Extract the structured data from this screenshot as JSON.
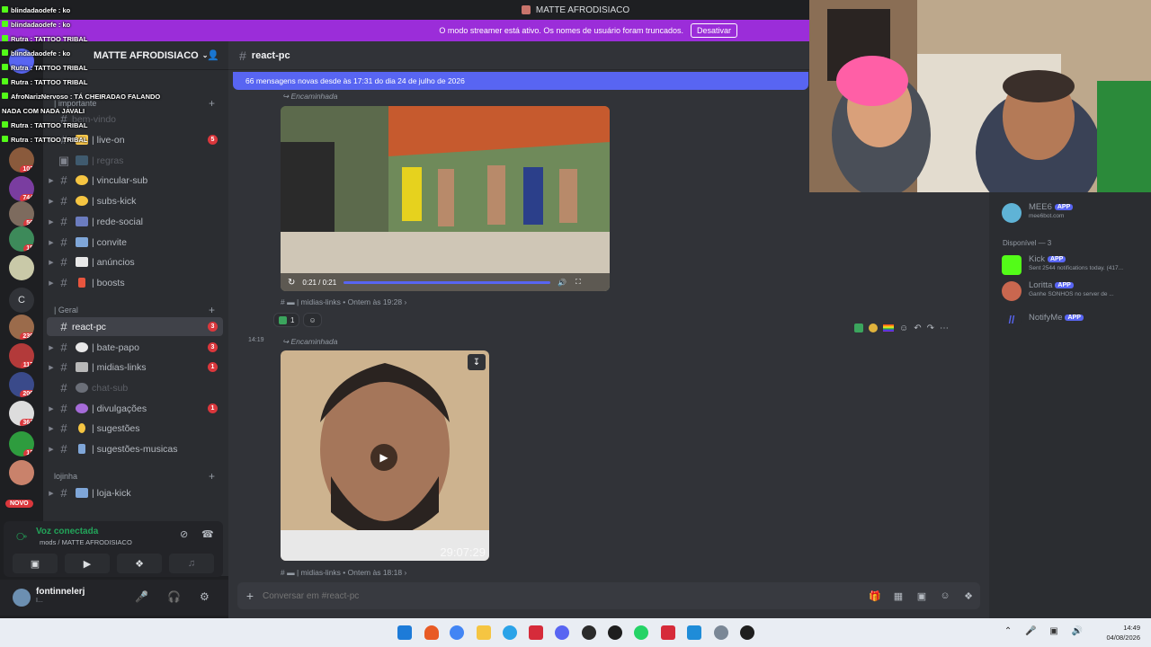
{
  "window": {
    "title": "MATTE AFRODISIACO"
  },
  "banner": {
    "text": "O modo streamer está ativo. Os nomes de usuário foram truncados.",
    "button": "Desativar"
  },
  "server": {
    "name": "MATTE AFRODISIACO"
  },
  "rail": {
    "letter": "C",
    "novo": "NOVO",
    "badges": [
      "103",
      "744",
      "50",
      "15",
      "239",
      "117",
      "206",
      "361",
      "13"
    ]
  },
  "categories": {
    "importante": "| importante",
    "geral": "| Geral",
    "lojinha": "lojinha"
  },
  "channels": [
    {
      "label": "bem-vindo",
      "muted": true,
      "count": ""
    },
    {
      "label": "| live-on",
      "muted": false,
      "count": "5"
    },
    {
      "label": "| regras",
      "muted": true,
      "count": ""
    },
    {
      "label": "| vincular-sub",
      "muted": false,
      "count": ""
    },
    {
      "label": "| subs-kick",
      "muted": false,
      "count": ""
    },
    {
      "label": "| rede-social",
      "muted": false,
      "count": ""
    },
    {
      "label": "| convite",
      "muted": false,
      "count": ""
    },
    {
      "label": "| anúncios",
      "muted": false,
      "count": ""
    },
    {
      "label": "| boosts",
      "muted": false,
      "count": ""
    },
    {
      "label": "react-pc",
      "muted": false,
      "count": "3"
    },
    {
      "label": "| bate-papo",
      "muted": false,
      "count": "3"
    },
    {
      "label": "| midias-links",
      "muted": false,
      "count": "1"
    },
    {
      "label": "chat-sub",
      "muted": true,
      "count": ""
    },
    {
      "label": "| divulgações",
      "muted": false,
      "count": "1"
    },
    {
      "label": "| sugestões",
      "muted": false,
      "count": ""
    },
    {
      "label": "| sugestões-musicas",
      "muted": false,
      "count": ""
    },
    {
      "label": "| loja-kick",
      "muted": false,
      "count": ""
    }
  ],
  "chat_overlay": [
    "blindadaodefe : ko",
    "blindadaodefe : ko",
    "Rutra : TATTOO TRIBAL",
    "blindadaodefe : ko",
    "Rutra : TATTOO TRIBAL",
    "Rutra : TATTOO TRIBAL",
    "AfroNarizNervoso : TÁ CHEIRADAO FALANDO",
    "NADA COM NADA JAVALI",
    "Rutra : TATTOO TRIBAL",
    "Rutra : TATTOO TRIBAL"
  ],
  "voice": {
    "status": "Voz conectada",
    "location": "mods / MATTE AFRODISIACO"
  },
  "user": {
    "name": "fontinnelerj",
    "status": "I..."
  },
  "channel": {
    "name": "react-pc"
  },
  "new_messages_bar": "66 mensagens novas desde às 17:31 do dia 24 de julho de 2026",
  "messages": [
    {
      "forwarded": "Encaminhada",
      "video_time": "0:21 / 0:21",
      "meta": "| midias-links • Ontem às 19:28 ›",
      "reaction_count": "1"
    },
    {
      "time": "14:19",
      "forwarded": "Encaminhada",
      "video_overlay": "29:07:29",
      "meta": "| midias-links • Ontem às 18:18 ›"
    }
  ],
  "composer": {
    "placeholder": "Conversar em #react-pc"
  },
  "members": {
    "available_header": "Disponível — 3",
    "list": [
      {
        "name": "MEE6",
        "sub": "mee6bot.com",
        "app": "APP"
      },
      {
        "name": "Kick",
        "sub": "Sent 2544 notifications today. (417...",
        "app": "APP"
      },
      {
        "name": "Loritta",
        "sub": "Ganhe SONHOS no server de ...",
        "app": "APP"
      },
      {
        "name": "NotifyMe",
        "sub": "",
        "app": "APP"
      }
    ]
  },
  "clock": {
    "time": "14:49",
    "date": "04/08/2026"
  },
  "colors": {
    "accent": "#5865f2",
    "banner": "#9b2dd9",
    "badge": "#da373c",
    "online": "#23a55a"
  }
}
